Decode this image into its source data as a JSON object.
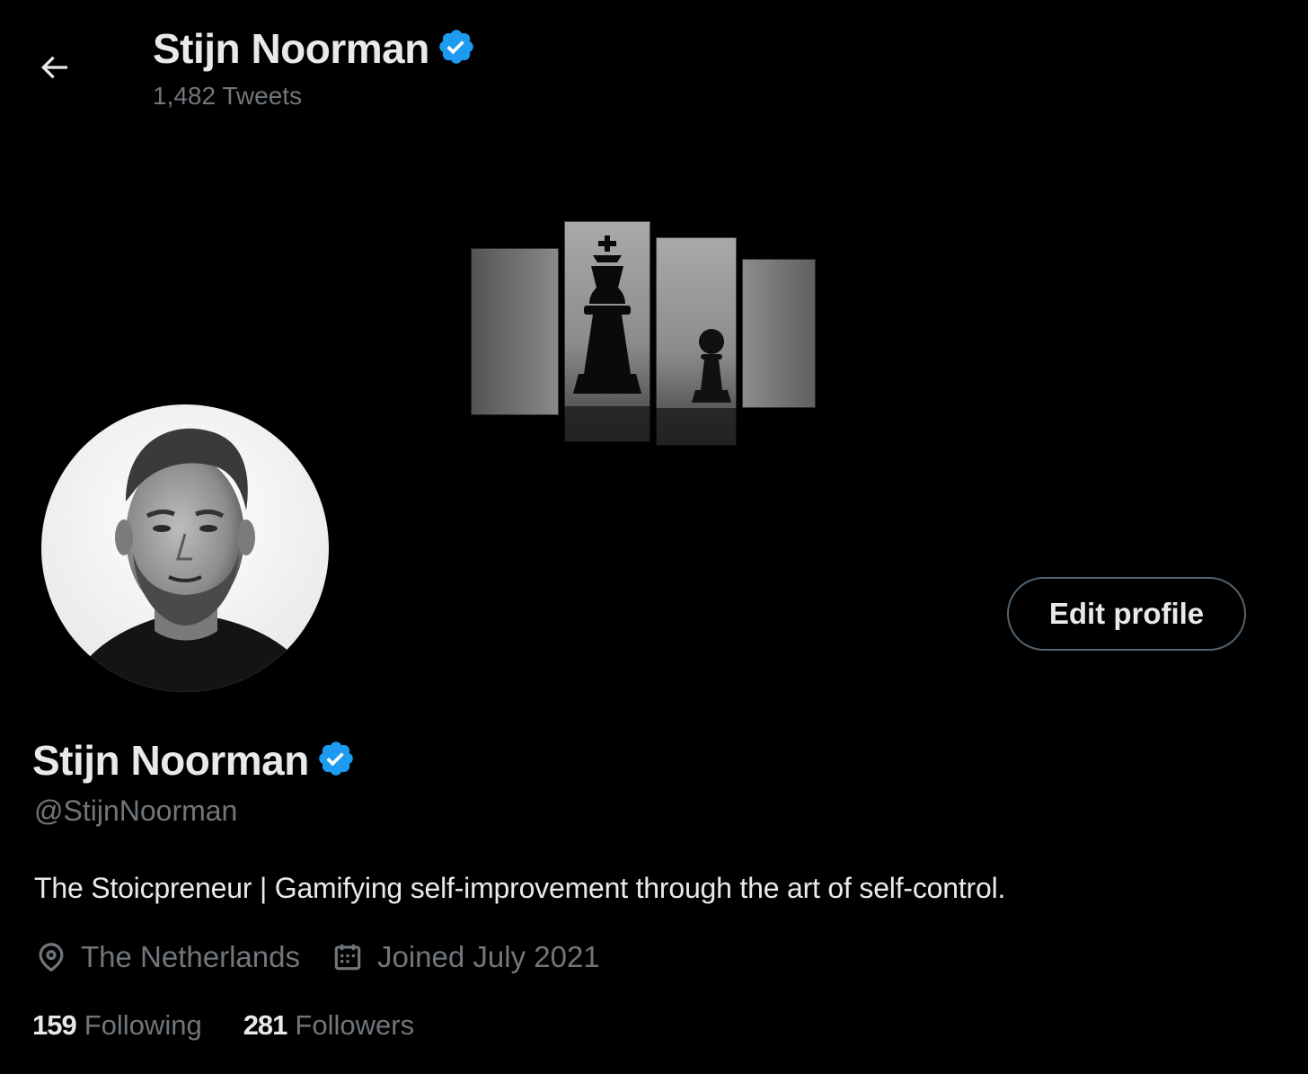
{
  "colors": {
    "background": "#000000",
    "primary_text": "#e7e9ea",
    "secondary_text": "#71767b",
    "verified_badge": "#1d9bf0",
    "button_border": "#536471"
  },
  "header": {
    "back_icon": "arrow-left-icon",
    "name": "Stijn Noorman",
    "tweet_count": "1,482 Tweets"
  },
  "banner": {
    "description_icon": "chess-king-and-pawn-canvas"
  },
  "profile": {
    "edit_button_label": "Edit profile",
    "name": "Stijn Noorman",
    "verified_icon": "verified-badge-icon",
    "handle": "@StijnNoorman",
    "bio": "The Stoicpreneur | Gamifying self-improvement through the art of self-control.",
    "location_icon": "location-pin-icon",
    "location": "The Netherlands",
    "joined_icon": "calendar-icon",
    "joined": "Joined July 2021",
    "following_count": "159",
    "following_label": "Following",
    "followers_count": "281",
    "followers_label": "Followers"
  }
}
